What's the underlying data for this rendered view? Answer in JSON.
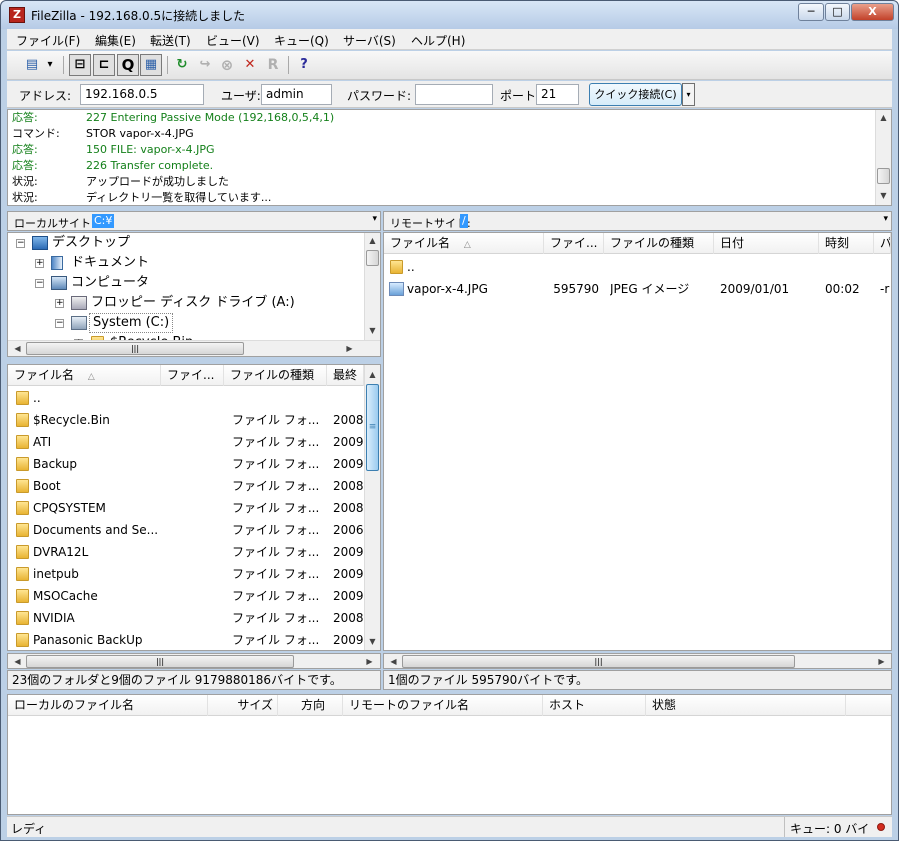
{
  "window": {
    "title": "FileZilla - 192.168.0.5に接続しました",
    "app_icon": "Z"
  },
  "window_controls": {
    "minimize": "─",
    "maximize": "□",
    "close": "X"
  },
  "menu": [
    "ファイル(F)",
    "編集(E)",
    "転送(T)",
    "ビュー(V)",
    "キュー(Q)",
    "サーバ(S)",
    "ヘルプ(H)"
  ],
  "toolbar": {
    "buttons": [
      {
        "icon": "site-manager-icon",
        "glyph": "▤"
      },
      {
        "icon": "dropdown-arrow-icon",
        "glyph": "▾"
      },
      {
        "icon": "toggle-log-icon",
        "glyph": "⊟"
      },
      {
        "icon": "toggle-local-tree-icon",
        "glyph": "⊏"
      },
      {
        "icon": "toggle-queue-icon",
        "glyph": "Q"
      },
      {
        "icon": "toggle-remote-tree-icon",
        "glyph": "▦"
      },
      {
        "icon": "refresh-icon",
        "glyph": "↻"
      },
      {
        "icon": "process-queue-icon",
        "glyph": "↪"
      },
      {
        "icon": "cancel-icon",
        "glyph": "⊗"
      },
      {
        "icon": "disconnect-icon",
        "glyph": "✕"
      },
      {
        "icon": "reconnect-icon",
        "glyph": "R"
      },
      {
        "icon": "search-icon",
        "glyph": "?"
      }
    ]
  },
  "quickconnect": {
    "host_label": "アドレス:",
    "host_value": "192.168.0.5",
    "user_label": "ユーザ:",
    "user_value": "admin",
    "pass_label": "パスワード:",
    "pass_value": "",
    "port_label": "ポート:",
    "port_value": "21",
    "button": "クイック接続(C)",
    "dropdown": "▾"
  },
  "log": [
    {
      "label": "応答:",
      "msg": "227 Entering Passive Mode (192,168,0,5,4,1)",
      "color": "#14801a"
    },
    {
      "label": "コマンド:",
      "msg": "STOR vapor-x-4.JPG",
      "color": "#000000"
    },
    {
      "label": "応答:",
      "msg": "150 FILE: vapor-x-4.JPG",
      "color": "#14801a"
    },
    {
      "label": "応答:",
      "msg": "226 Transfer complete.",
      "color": "#14801a"
    },
    {
      "label": "状況:",
      "msg": "アップロードが成功しました",
      "color": "#000000"
    },
    {
      "label": "状況:",
      "msg": "ディレクトリ一覧を取得しています...",
      "color": "#000000"
    }
  ],
  "local": {
    "site_label": "ローカルサイト:",
    "site_value": "C:¥",
    "tree": [
      {
        "label": "デスクトップ",
        "expander": "−",
        "icon": "desktop-icon"
      },
      {
        "label": "ドキュメント",
        "expander": "+",
        "icon": "documents-icon"
      },
      {
        "label": "コンピュータ",
        "expander": "−",
        "icon": "computer-icon"
      },
      {
        "label": "フロッピー ディスク ドライブ (A:)",
        "expander": "+",
        "icon": "floppy-icon"
      },
      {
        "label": "System (C:)",
        "expander": "−",
        "icon": "drive-icon"
      },
      {
        "label": "$Recycle.Bin",
        "expander": "+",
        "icon": "folder-icon"
      }
    ],
    "headers": [
      "ファイル名",
      "ファイ...",
      "ファイルの種類",
      "最終"
    ],
    "files": [
      {
        "name": "..",
        "size": "",
        "type": "",
        "date": ""
      },
      {
        "name": "$Recycle.Bin",
        "size": "",
        "type": "ファイル フォ...",
        "date": "2008"
      },
      {
        "name": "ATI",
        "size": "",
        "type": "ファイル フォ...",
        "date": "2009"
      },
      {
        "name": "Backup",
        "size": "",
        "type": "ファイル フォ...",
        "date": "2009"
      },
      {
        "name": "Boot",
        "size": "",
        "type": "ファイル フォ...",
        "date": "2008"
      },
      {
        "name": "CPQSYSTEM",
        "size": "",
        "type": "ファイル フォ...",
        "date": "2008"
      },
      {
        "name": "Documents and Se...",
        "size": "",
        "type": "ファイル フォ...",
        "date": "2006"
      },
      {
        "name": "DVRA12L",
        "size": "",
        "type": "ファイル フォ...",
        "date": "2009"
      },
      {
        "name": "inetpub",
        "size": "",
        "type": "ファイル フォ...",
        "date": "2009"
      },
      {
        "name": "MSOCache",
        "size": "",
        "type": "ファイル フォ...",
        "date": "2009"
      },
      {
        "name": "NVIDIA",
        "size": "",
        "type": "ファイル フォ...",
        "date": "2008"
      },
      {
        "name": "Panasonic BackUp",
        "size": "",
        "type": "ファイル フォ...",
        "date": "2009"
      }
    ],
    "status": "23個のフォルダと9個のファイル  9179880186バイトです。"
  },
  "remote": {
    "site_label": "リモートサイト:",
    "site_value": "/",
    "headers": [
      "ファイル名",
      "ファイ...",
      "ファイルの種類",
      "日付",
      "時刻",
      "パ"
    ],
    "files": [
      {
        "name": "..",
        "size": "",
        "type": "",
        "date": "",
        "time": "",
        "perm": "",
        "kind": "folder"
      },
      {
        "name": "vapor-x-4.JPG",
        "size": "595790",
        "type": "JPEG イメージ",
        "date": "2009/01/01",
        "time": "00:02",
        "perm": "-r",
        "kind": "image"
      }
    ],
    "status": "1個のファイル  595790バイトです。"
  },
  "queue": {
    "headers": [
      "ローカルのファイル名",
      "サイズ",
      "方向",
      "リモートのファイル名",
      "ホスト",
      "状態"
    ]
  },
  "statusbar": {
    "left": "レディ",
    "right": "キュー: 0 バイ"
  },
  "scroll": {
    "up": "▲",
    "down": "▼",
    "left": "◀",
    "right": "▶",
    "grip": "≡",
    "hgrip": "|||"
  },
  "sort_arrow": "△",
  "colors": {
    "accent": "#3399ff",
    "log_green": "#14801a"
  }
}
